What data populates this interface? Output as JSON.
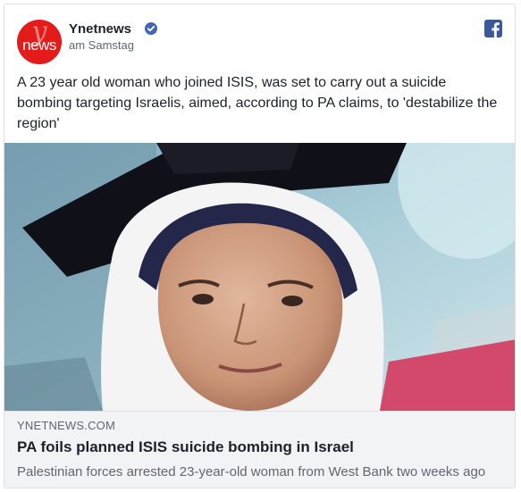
{
  "post": {
    "page_name": "Ynetnews",
    "avatar_text": "news",
    "avatar_letter": "y",
    "timestamp": "am Samstag",
    "text": "A 23 year old woman who joined ISIS, was set to carry out a suicide bombing targeting Israelis, aimed, according to PA claims, to 'destabilize the region'",
    "verified_icon": "verified-check-icon",
    "platform_icon": "facebook-icon"
  },
  "link_preview": {
    "domain": "YNETNEWS.COM",
    "headline": "PA foils planned ISIS suicide bombing in Israel",
    "description": "Palestinian forces arrested 23-year-old woman from West Bank two weeks ago"
  },
  "colors": {
    "brand_red": "#e41b1b",
    "facebook_blue": "#3b5998",
    "verified_blue": "#4267b2",
    "link_box_bg": "#f2f3f5"
  }
}
